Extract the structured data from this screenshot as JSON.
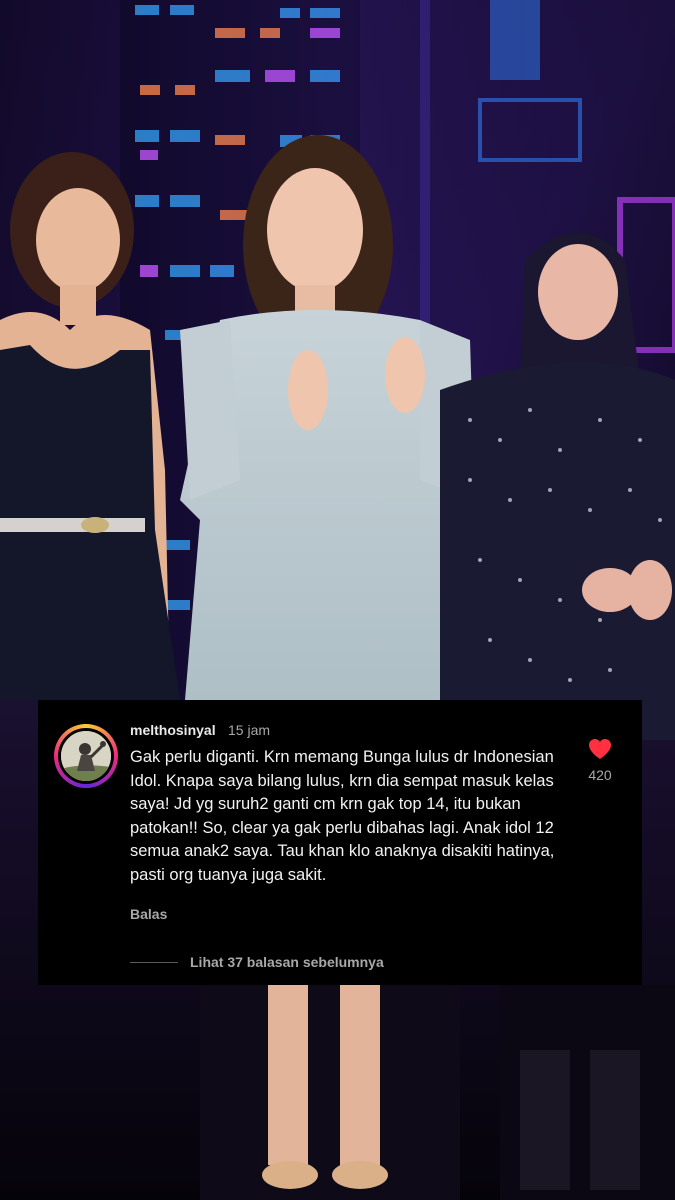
{
  "background": {
    "description_icon": "stage-photo-three-singers"
  },
  "comment": {
    "avatar_icon": "profile-avatar",
    "username": "melthosinyal",
    "time": "15 jam",
    "text": "Gak perlu diganti. Krn memang Bunga lulus dr Indonesian Idol. Knapa saya bilang lulus, krn dia sempat masuk kelas saya! Jd yg suruh2 ganti cm krn gak top 14, itu bukan patokan!! So, clear ya gak perlu dibahas lagi. Anak idol 12 semua anak2 saya. Tau khan klo anaknya disakiti hatinya, pasti org tuanya juga sakit.",
    "like_icon": "heart-filled-icon",
    "like_color": "#ff3040",
    "like_count": "420",
    "reply_label": "Balas",
    "view_replies_label": "Lihat 37 balasan sebelumnya"
  }
}
